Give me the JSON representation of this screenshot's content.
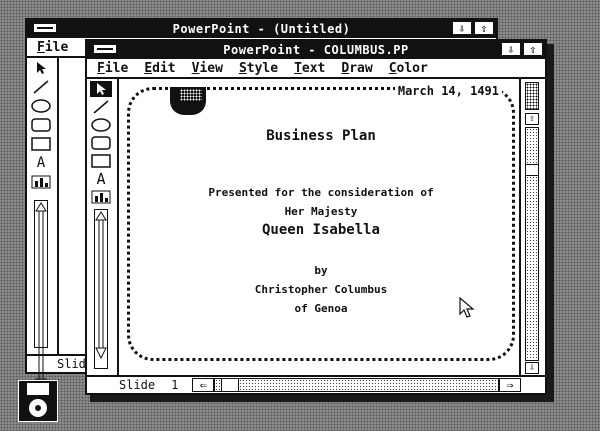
{
  "back_window": {
    "title": "PowerPoint - (Untitled)",
    "menu_file": "File",
    "status_slide": "Slid",
    "arrow_down": "⇩",
    "arrow_up": "⇧"
  },
  "front_window": {
    "title": "PowerPoint - COLUMBUS.PP",
    "arrow_down": "⇩",
    "arrow_up": "⇧",
    "menu": [
      "File",
      "Edit",
      "View",
      "Style",
      "Text",
      "Draw",
      "Color"
    ],
    "tools": [
      "select-arrow",
      "line",
      "ellipse",
      "rounded-rectangle",
      "rectangle",
      "text",
      "graph"
    ],
    "text_tool_glyph": "A",
    "status": {
      "slide_label": "Slide",
      "slide_number": "1",
      "prev_arrow": "⇐",
      "next_arrow": "⇒"
    }
  },
  "slide": {
    "date": "March 14, 1491",
    "title": "Business Plan",
    "line1": "Presented for the consideration of",
    "line2": "Her Majesty",
    "line3": "Queen Isabella",
    "line4": "by",
    "line5": "Christopher Columbus",
    "line6": "of Genoa"
  },
  "desktop": {
    "disk_icon": "floppy-disk-icon",
    "cursor_icon": "mouse-pointer-icon"
  }
}
